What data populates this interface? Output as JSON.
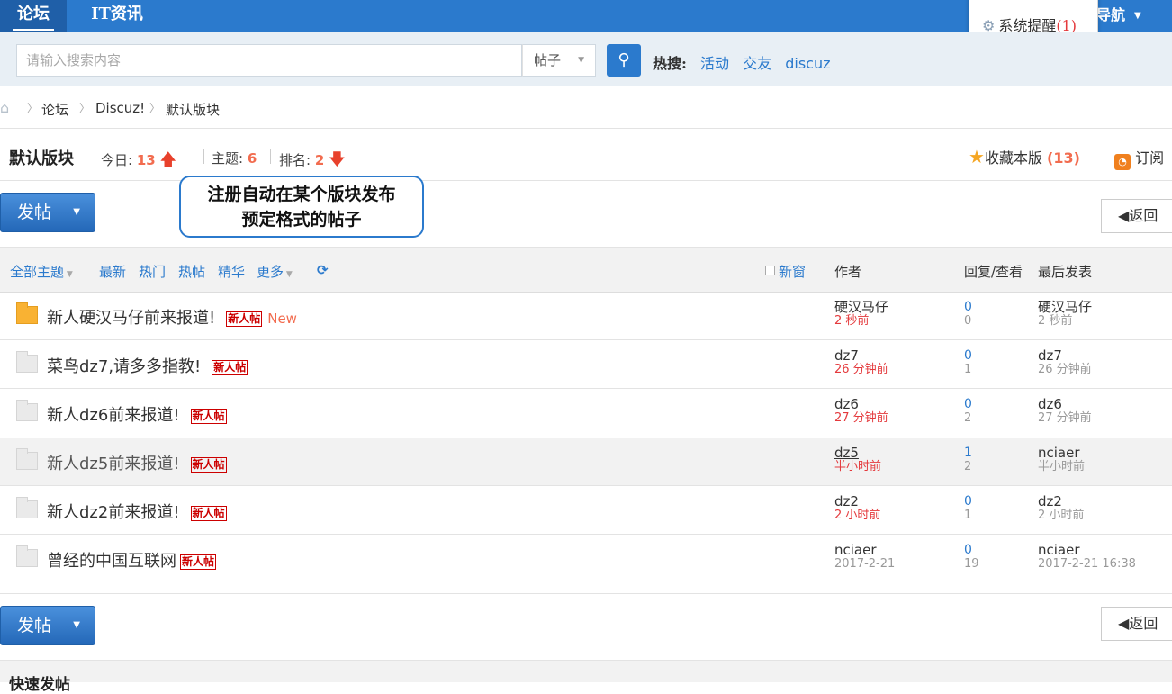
{
  "nav": {
    "tabs": [
      {
        "label": "论坛"
      },
      {
        "label": "IT资讯"
      }
    ],
    "right": "导航",
    "popup_item": "系统提醒",
    "popup_count": "(1)"
  },
  "search": {
    "placeholder": "请输入搜索内容",
    "type": "帖子",
    "hot_label": "热搜:",
    "hot": [
      "活动",
      "交友",
      "discuz"
    ]
  },
  "breadcrumb": [
    "论坛",
    "Discuz!",
    "默认版块"
  ],
  "forum": {
    "title": "默认版块",
    "today_label": "今日:",
    "today": "13",
    "threads_label": "主题:",
    "threads": "6",
    "rank_label": "排名:",
    "rank": "2",
    "fav_label": "收藏本版",
    "fav_count": "(13)",
    "rss_label": "订阅"
  },
  "buttons": {
    "post": "发帖",
    "back": "返回"
  },
  "callout": {
    "line1": "注册自动在某个版块发布",
    "line2": "预定格式的帖子"
  },
  "filters": {
    "all": "全部主题",
    "latest": "最新",
    "hot": "热门",
    "hotpost": "热帖",
    "digest": "精华",
    "more": "更多",
    "newwin": "新窗",
    "author": "作者",
    "replies": "回复/查看",
    "lastpost": "最后发表"
  },
  "threads": [
    {
      "title": "新人硬汉马仔前来报道!",
      "tag": "新人帖",
      "new": "New",
      "author": "硬汉马仔",
      "time": "2 秒前",
      "replies": "0",
      "views": "0",
      "last_user": "硬汉马仔",
      "last_time": "2 秒前"
    },
    {
      "title": "菜鸟dz7,请多多指教!",
      "tag": "新人帖",
      "author": "dz7",
      "time": "26 分钟前",
      "replies": "0",
      "views": "1",
      "last_user": "dz7",
      "last_time": "26 分钟前"
    },
    {
      "title": "新人dz6前来报道!",
      "tag": "新人帖",
      "author": "dz6",
      "time": "27 分钟前",
      "replies": "0",
      "views": "2",
      "last_user": "dz6",
      "last_time": "27 分钟前"
    },
    {
      "title": "新人dz5前来报道!",
      "tag": "新人帖",
      "author": "dz5",
      "time": "半小时前",
      "replies": "1",
      "views": "2",
      "last_user": "nciaer",
      "last_time": "半小时前"
    },
    {
      "title": "新人dz2前来报道!",
      "tag": "新人帖",
      "author": "dz2",
      "time": "2 小时前",
      "replies": "0",
      "views": "1",
      "last_user": "dz2",
      "last_time": "2 小时前"
    },
    {
      "title": "曾经的中国互联网",
      "tag": "新人帖",
      "author": "nciaer",
      "time": "2017-2-21",
      "replies": "0",
      "views": "19",
      "last_user": "nciaer",
      "last_time": "2017-2-21 16:38"
    }
  ],
  "quick_post": "快速发帖",
  "colors": {
    "brand": "#2b7acd",
    "accent": "#f26c4f",
    "tag": "#cc0000"
  }
}
